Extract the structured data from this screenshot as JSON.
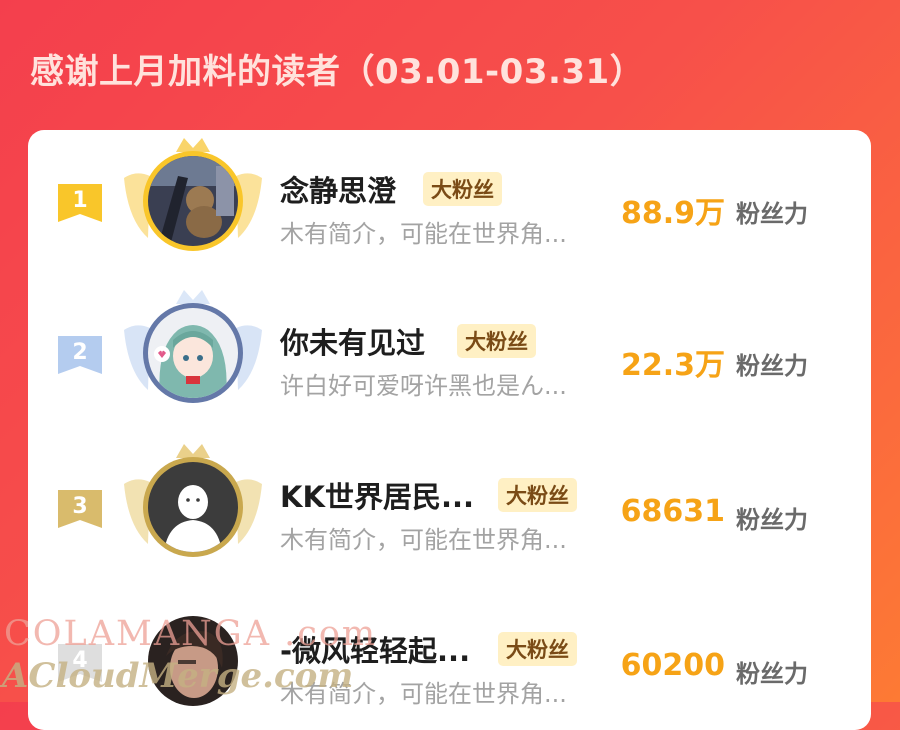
{
  "title": "感谢上月加料的读者（03.01-03.31）",
  "score_label": "粉丝力",
  "readers": [
    {
      "rank": "1",
      "name": "念静思澄",
      "badge": "大粉丝",
      "desc": "木有简介，可能在世界角...",
      "score": "88.9万",
      "tier": "gold",
      "avatar": "photo-dark-avatar"
    },
    {
      "rank": "2",
      "name": "你未有见过",
      "badge": "大粉丝",
      "desc": "许白好可爱呀许黑也是ん...",
      "score": "22.3万",
      "tier": "silver",
      "avatar": "anime-girl-avatar"
    },
    {
      "rank": "3",
      "name": "KK世界居民...",
      "badge": "大粉丝",
      "desc": "木有简介，可能在世界角...",
      "score": "68631",
      "tier": "bronze",
      "avatar": "default-ghost-avatar"
    },
    {
      "rank": "4",
      "name": "-微风轻轻起...",
      "badge": "大粉丝",
      "desc": "木有简介，可能在世界角...",
      "score": "60200",
      "tier": "none",
      "avatar": "photo-person-avatar"
    }
  ],
  "watermark": {
    "line1": "COLAMANGA .com",
    "line2": "ACloudMerge.com"
  },
  "colors": {
    "background_start": "#f43f4d",
    "background_end": "#fd7a34",
    "score": "#f6a316",
    "badge_bg": "#fff0c4",
    "gold": "#f9c62a",
    "silver": "#b4ccef",
    "bronze": "#d9bb6c"
  }
}
